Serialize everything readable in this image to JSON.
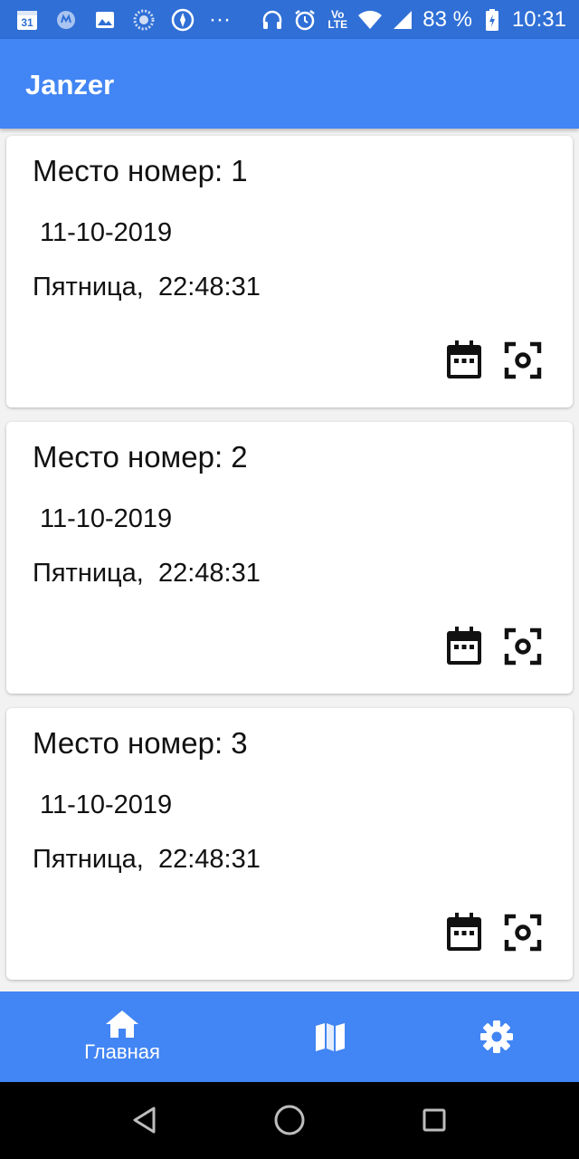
{
  "status_bar": {
    "calendar_day": "31",
    "battery_percent": "83 %",
    "time": "10:31",
    "network_top": "Vo",
    "network_bottom": "LTE",
    "more": "···"
  },
  "app_bar": {
    "title": "Janzer"
  },
  "cards": [
    {
      "title": "Место номер: 1",
      "date": "11-10-2019",
      "time": "Пятница,  22:48:31"
    },
    {
      "title": "Место номер: 2",
      "date": "11-10-2019",
      "time": "Пятница,  22:48:31"
    },
    {
      "title": "Место номер: 3",
      "date": "11-10-2019",
      "time": "Пятница,  22:48:31"
    }
  ],
  "bottom_nav": {
    "home_label": "Главная",
    "items": [
      "home-icon",
      "map-icon",
      "gear-icon"
    ]
  },
  "colors": {
    "status_bar": "#2f6fd6",
    "primary": "#4285f4",
    "background": "#f2f2f2",
    "card": "#ffffff",
    "system_nav": "#000000"
  }
}
